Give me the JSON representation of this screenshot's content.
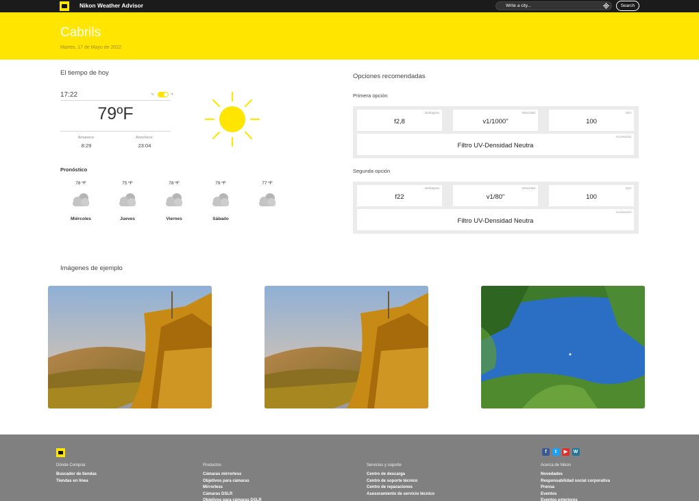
{
  "navbar": {
    "app_title": "Nikon Weather Advisor",
    "search_placeholder": "Write a city...",
    "search_button": "Search"
  },
  "hero": {
    "city": "Cabrils",
    "date": "Martes, 17 de Mayo de 2022"
  },
  "today": {
    "title": "El tiempo de hoy",
    "time": "17:22",
    "unit_c": "ºC",
    "unit_f": "ºF",
    "unit_selected": "ºF",
    "temperature": "79ºF",
    "sunrise_label": "Amanece:",
    "sunrise": "8:29",
    "sunset_label": "Anochece:",
    "sunset": "23:04",
    "condition_icon": "sun-icon"
  },
  "forecast": {
    "title": "Pronóstico",
    "days": [
      {
        "temp": "78 ºF",
        "day": "Miércoles",
        "icon": "cloud-icon"
      },
      {
        "temp": "75 ºF",
        "day": "Jueves",
        "icon": "cloud-icon"
      },
      {
        "temp": "78 ºF",
        "day": "Viernes",
        "icon": "cloud-icon"
      },
      {
        "temp": "79 ºF",
        "day": "Sábado",
        "icon": "cloud-icon"
      },
      {
        "temp": "77 ºF",
        "day": "",
        "icon": "cloud-icon"
      }
    ]
  },
  "options": {
    "title": "Opciones recomendadas",
    "first": {
      "label": "Primera opción",
      "aperture_label": "Diafragma:",
      "aperture": "f2,8",
      "speed_label": "Velocidad:",
      "speed": "v1/1000\"",
      "iso_label": "ISO:",
      "iso": "100",
      "accessories_label": "Accesorios:",
      "accessories": "Filtro UV-Densidad Neutra"
    },
    "second": {
      "label": "Segunda opción",
      "aperture_label": "Diafragma:",
      "aperture": "f22",
      "speed_label": "Velocidad:",
      "speed": "v1/80\"",
      "iso_label": "ISO:",
      "iso": "100",
      "accessories_label": "Accesorios:",
      "accessories": "Filtro UV-Densidad Neutra"
    }
  },
  "gallery": {
    "title": "Imágenes de ejemplo"
  },
  "footer": {
    "columns": [
      {
        "heading": "Dónde Comprar",
        "links": [
          "Buscador de tiendas",
          "Tiendas en línea"
        ]
      },
      {
        "heading": "Productos",
        "links": [
          "Cámaras mirrorless",
          "Objetivos para cámaras",
          "Mirrorless",
          "Cámaras DSLR",
          "Objetivos para cámaras DSLR"
        ]
      },
      {
        "heading": "Servicios y soporte",
        "links": [
          "Centro de descarga",
          "Centro de soporte técnico",
          "Centro de reparaciones",
          "Asesoramiento de servicio técnico"
        ]
      },
      {
        "heading": "Acerca de Nikon",
        "links": [
          "Novedades",
          "Responsabilidad social corporativa",
          "Prensa",
          "Eventos",
          "Eventos exteriores"
        ]
      }
    ],
    "social": [
      {
        "icon": "facebook-icon",
        "glyph": "f",
        "color": "#3b5998"
      },
      {
        "icon": "twitter-icon",
        "glyph": "t",
        "color": "#1da1f2"
      },
      {
        "icon": "youtube-icon",
        "glyph": "▶",
        "color": "#e52d27"
      },
      {
        "icon": "wordpress-icon",
        "glyph": "W",
        "color": "#21759b"
      }
    ]
  }
}
